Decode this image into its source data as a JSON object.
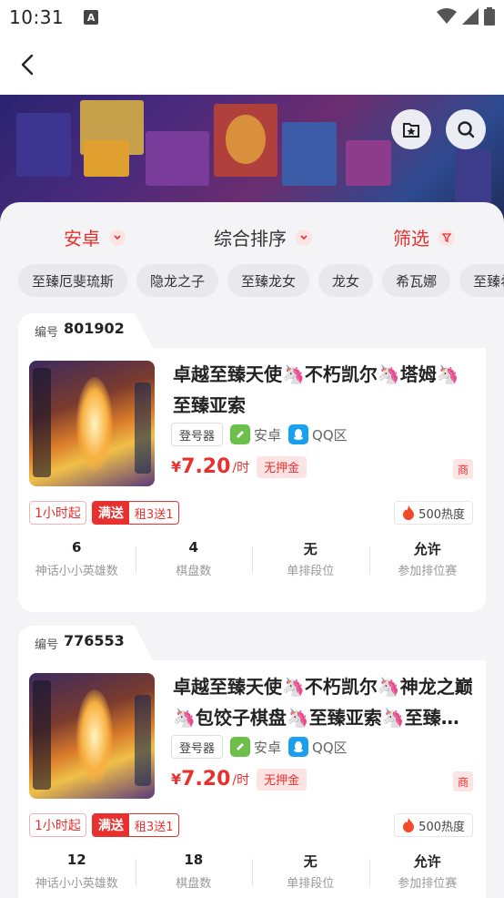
{
  "status_bar": {
    "time": "10:31",
    "notif_letter": "A"
  },
  "filters": {
    "platform": "安卓",
    "sort": "综合排序",
    "filter": "筛选"
  },
  "hero_tags": [
    "至臻厄斐琉斯",
    "隐龙之子",
    "至臻龙女",
    "龙女",
    "希瓦娜",
    "至臻希"
  ],
  "cards": [
    {
      "id_label": "编号",
      "id": "801902",
      "title": "卓越至臻天使🦄不朽凯尔🦄塔姆🦄至臻亚索",
      "login_tag": "登号器",
      "platform": "安卓",
      "region": "QQ区",
      "price_symbol": "¥",
      "price": "7.20",
      "price_unit": "/时",
      "deposit": "无押金",
      "merchant": "商",
      "min_hours": "1小时起",
      "deal_a": "满送",
      "deal_b": "租3送1",
      "heat": "500热度",
      "stats": [
        {
          "value": "6",
          "label": "神话小小英雄数"
        },
        {
          "value": "4",
          "label": "棋盘数"
        },
        {
          "value": "无",
          "label": "单排段位"
        },
        {
          "value": "允许",
          "label": "参加排位赛"
        }
      ]
    },
    {
      "id_label": "编号",
      "id": "776553",
      "title": "卓越至臻天使🦄不朽凯尔🦄神龙之巅🦄包饺子棋盘🦄至臻亚索🦄至臻辛…",
      "login_tag": "登号器",
      "platform": "安卓",
      "region": "QQ区",
      "price_symbol": "¥",
      "price": "7.20",
      "price_unit": "/时",
      "deposit": "无押金",
      "merchant": "商",
      "min_hours": "1小时起",
      "deal_a": "满送",
      "deal_b": "租3送1",
      "heat": "500热度",
      "stats": [
        {
          "value": "12",
          "label": "神话小小英雄数"
        },
        {
          "value": "18",
          "label": "棋盘数"
        },
        {
          "value": "无",
          "label": "单排段位"
        },
        {
          "value": "允许",
          "label": "参加排位赛"
        }
      ]
    }
  ],
  "colors": {
    "accent": "#e8302f",
    "accent_soft": "#fde4e4",
    "android_green": "#6cc04a",
    "qq_blue": "#1aa0f0",
    "fire": "#f04a2a"
  },
  "icons": [
    "back-arrow-icon",
    "favorite-icon",
    "search-icon",
    "chevron-down-icon",
    "filter-icon",
    "android-icon",
    "qq-icon",
    "fire-icon",
    "wifi-icon",
    "signal-icon",
    "battery-icon"
  ]
}
